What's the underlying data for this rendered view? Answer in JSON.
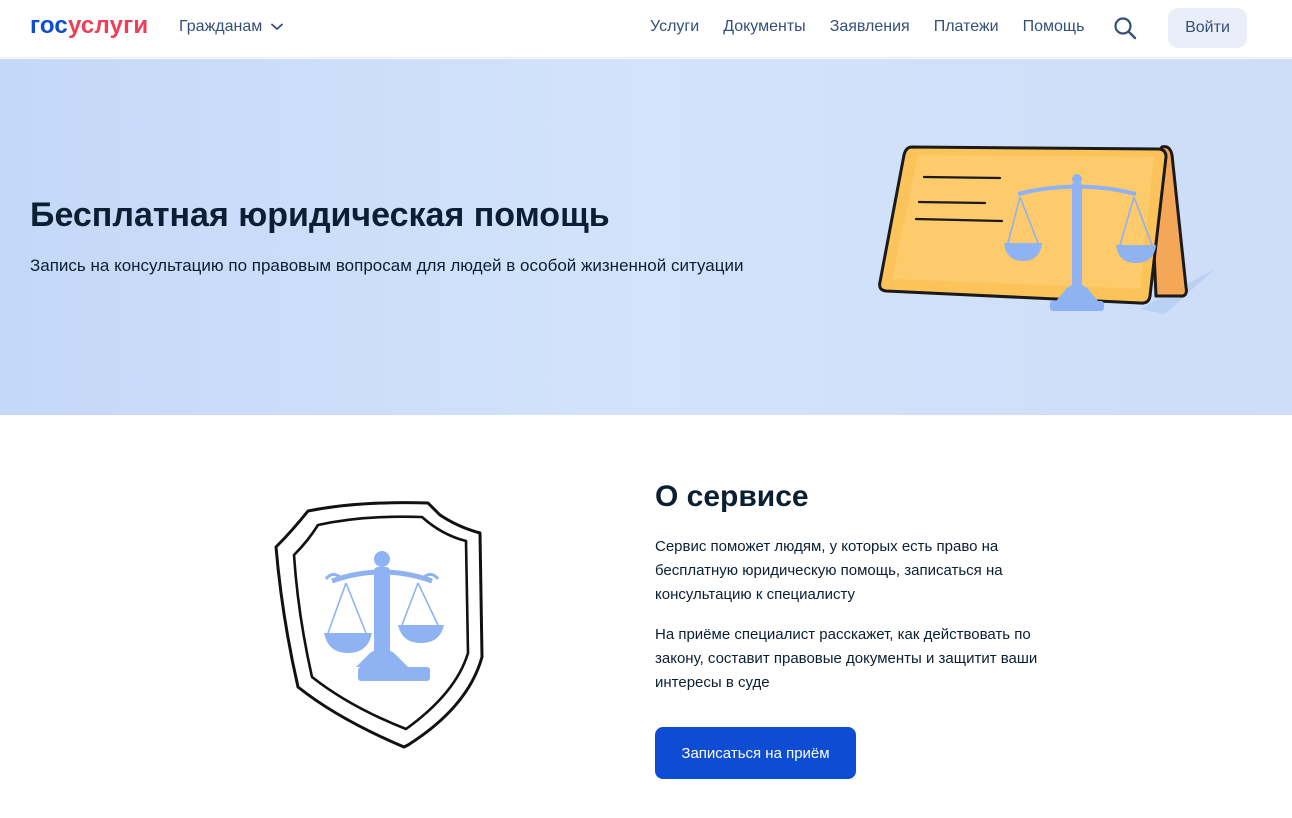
{
  "header": {
    "logo_part1": "гос",
    "logo_part2": "услуги",
    "role_label": "Гражданам",
    "nav": [
      "Услуги",
      "Документы",
      "Заявления",
      "Платежи",
      "Помощь"
    ],
    "login_label": "Войти",
    "icons": {
      "search": "search-icon",
      "role_dropdown": "chevron-down-icon"
    }
  },
  "hero": {
    "title": "Бесплатная юридическая помощь",
    "subtitle": "Запись на консультацию по правовым вопросам для людей в особой жизненной ситуации",
    "illustration": "desk-nameplate-scales-illustration"
  },
  "about": {
    "title": "О сервисе",
    "paragraphs": [
      "Сервис поможет людям, у которых есть право на бесплатную юридическую помощь, записаться на консультацию к специалисту",
      "На приёме специалист расскажет, как действовать по закону, составит правовые документы и защитит ваши интересы в суде"
    ],
    "cta_label": "Записаться на приём",
    "illustration": "shield-scales-illustration"
  },
  "colors": {
    "brand_blue": "#0d4cd3",
    "brand_red": "#ee3f58",
    "text_dark": "#0b1f33",
    "nav_text": "#335079",
    "hero_bg": "#cfe0fa",
    "nameplate": "#fcc35a",
    "scales": "#8fb2f2"
  }
}
